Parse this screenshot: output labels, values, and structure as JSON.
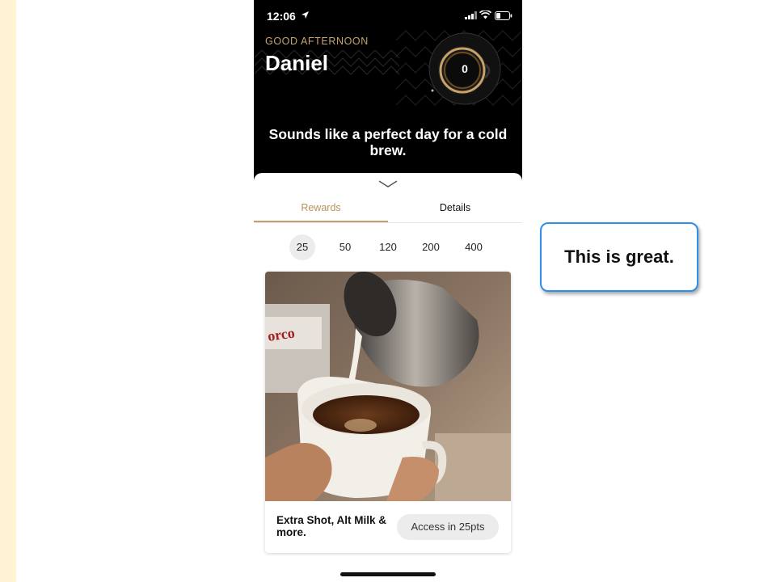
{
  "status_bar": {
    "time": "12:06",
    "icons": [
      "location-arrow-icon",
      "signal-icon",
      "wifi-icon",
      "battery-icon"
    ]
  },
  "header": {
    "greeting": "GOOD AFTERNOON",
    "name": "Daniel",
    "points": "0",
    "tagline": "Sounds like a perfect day for a cold brew."
  },
  "tabs": [
    {
      "label": "Rewards",
      "active": true
    },
    {
      "label": "Details",
      "active": false
    }
  ],
  "tiers": [
    {
      "label": "25",
      "active": true
    },
    {
      "label": "50",
      "active": false
    },
    {
      "label": "120",
      "active": false
    },
    {
      "label": "200",
      "active": false
    },
    {
      "label": "400",
      "active": false
    }
  ],
  "reward_card": {
    "title": "Extra Shot, Alt Milk & more.",
    "button_label": "Access in 25pts",
    "image": "latte-pour-photo"
  },
  "annotation": {
    "text": "This is great."
  },
  "colors": {
    "accent_gold": "#c2a06c",
    "header_bg": "#000000",
    "bubble_border": "#2f8eea",
    "side_strip": "#fff3d4"
  }
}
